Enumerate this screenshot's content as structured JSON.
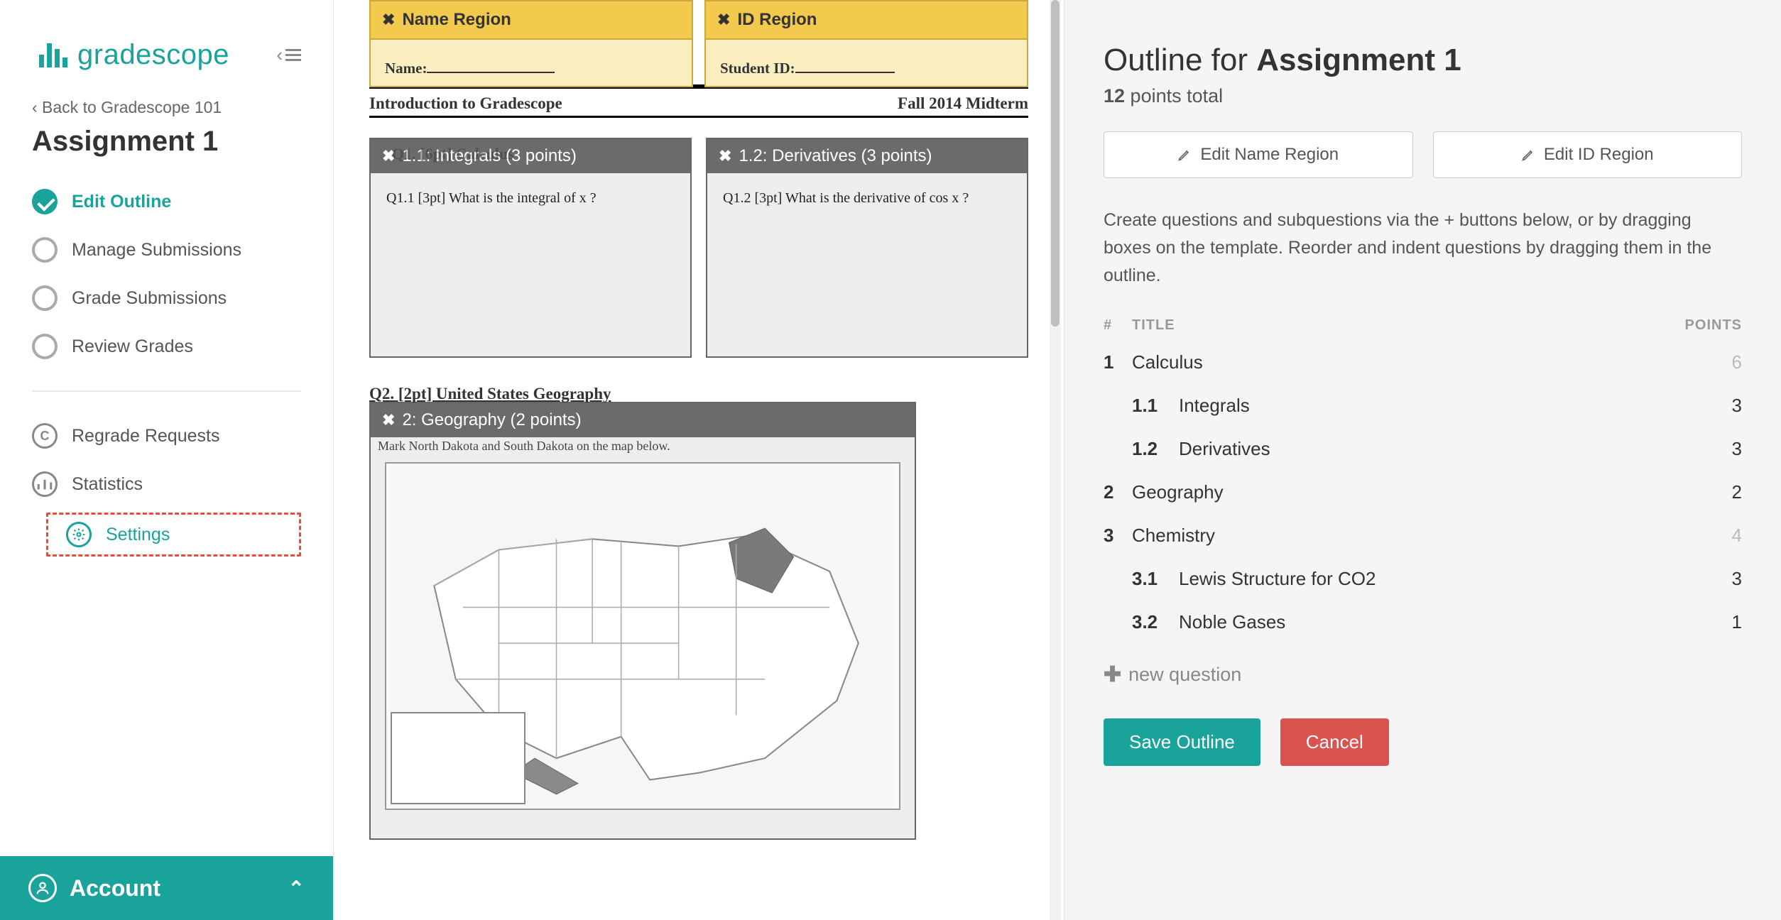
{
  "brand": {
    "name": "gradescope"
  },
  "sidebar": {
    "back_label": "‹ Back to Gradescope 101",
    "assignment_title": "Assignment 1",
    "steps": [
      {
        "label": "Edit Outline",
        "active": true
      },
      {
        "label": "Manage Submissions",
        "active": false
      },
      {
        "label": "Grade Submissions",
        "active": false
      },
      {
        "label": "Review Grades",
        "active": false
      }
    ],
    "secondary": [
      {
        "label": "Regrade Requests",
        "icon": "regrade-icon"
      },
      {
        "label": "Statistics",
        "icon": "stats-icon"
      },
      {
        "label": "Settings",
        "icon": "settings-icon",
        "highlighted": true
      }
    ],
    "account_label": "Account"
  },
  "template": {
    "name_region_label": "Name Region",
    "id_region_label": "ID Region",
    "name_field_label": "Name:",
    "id_field_label": "Student ID:",
    "doc_left": "Introduction to Gradescope",
    "doc_right": "Fall 2014 Midterm",
    "q11_overlay": "1.1: Integrals (3 points)",
    "q11_hidden": "Q1.  [6pt] Calculus",
    "q11_body": "Q1.1   [3pt]  What is the integral of x ?",
    "q12_overlay": "1.2: Derivatives (3 points)",
    "q12_body": "Q1.2   [3pt]   What is the derivative of  cos x ?",
    "q2_title": "Q2.   [2pt] United States Geography",
    "q2_overlay": "2: Geography (2 points)",
    "q2_sub": "Mark North Dakota and South Dakota on the map below."
  },
  "outline": {
    "heading_prefix": "Outline for ",
    "heading_name": "Assignment 1",
    "points_value": "12",
    "points_suffix": " points total",
    "edit_name_btn": "Edit Name Region",
    "edit_id_btn": "Edit ID Region",
    "help_text": "Create questions and subquestions via the + buttons below, or by dragging boxes on the template. Reorder and indent questions by dragging them in the outline.",
    "col_num": "#",
    "col_title": "TITLE",
    "col_points": "POINTS",
    "rows": [
      {
        "num": "1",
        "title": "Calculus",
        "points": "6",
        "level": "top"
      },
      {
        "num": "1.1",
        "title": "Integrals",
        "points": "3",
        "level": "sub"
      },
      {
        "num": "1.2",
        "title": "Derivatives",
        "points": "3",
        "level": "sub"
      },
      {
        "num": "2",
        "title": "Geography",
        "points": "2",
        "level": "top-leaf"
      },
      {
        "num": "3",
        "title": "Chemistry",
        "points": "4",
        "level": "top"
      },
      {
        "num": "3.1",
        "title": "Lewis Structure for CO2",
        "points": "3",
        "level": "sub"
      },
      {
        "num": "3.2",
        "title": "Noble Gases",
        "points": "1",
        "level": "sub"
      }
    ],
    "new_question_label": "new question",
    "save_label": "Save Outline",
    "cancel_label": "Cancel"
  }
}
